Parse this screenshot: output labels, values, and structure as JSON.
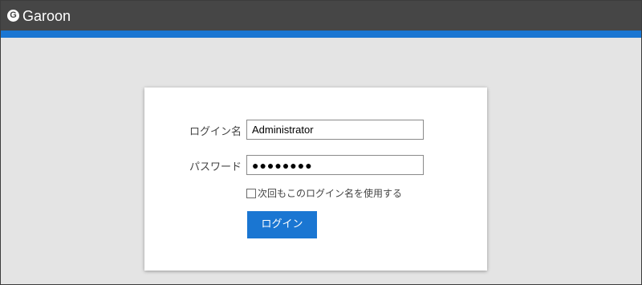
{
  "header": {
    "logo_mark": "G",
    "app_name": "Garoon"
  },
  "colors": {
    "header_bg": "#464646",
    "accent": "#1a76d2",
    "page_bg": "#e4e4e4"
  },
  "login_form": {
    "login_name_label": "ログイン名",
    "login_name_value": "Administrator",
    "password_label": "パスワード",
    "password_value": "●●●●●●●●",
    "remember_checked": false,
    "remember_label": "次回もこのログイン名を使用する",
    "submit_label": "ログイン"
  }
}
